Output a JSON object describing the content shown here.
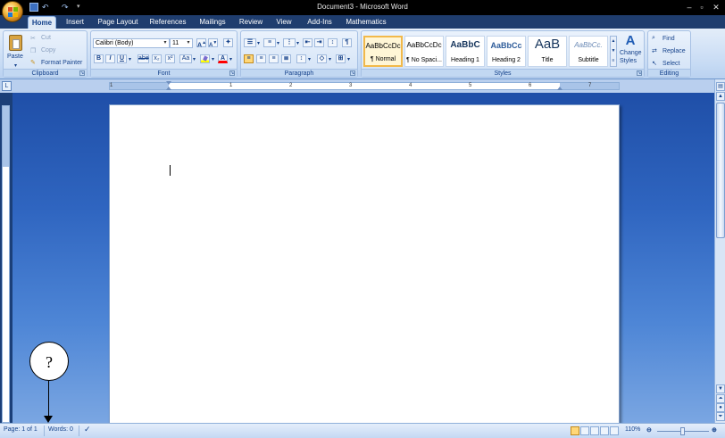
{
  "window": {
    "title": "Document3 - Microsoft Word"
  },
  "tabs": [
    {
      "label": "Home",
      "active": true
    },
    {
      "label": "Insert"
    },
    {
      "label": "Page Layout"
    },
    {
      "label": "References"
    },
    {
      "label": "Mailings"
    },
    {
      "label": "Review"
    },
    {
      "label": "View"
    },
    {
      "label": "Add-Ins"
    },
    {
      "label": "Mathematics"
    }
  ],
  "clipboard": {
    "paste": "Paste",
    "cut": "Cut",
    "copy": "Copy",
    "format_painter": "Format Painter",
    "group_label": "Clipboard"
  },
  "font": {
    "name": "Calibri (Body)",
    "size": "11",
    "group_label": "Font",
    "bold": "B",
    "italic": "I",
    "underline": "U",
    "strike": "abe",
    "subscript": "x₂",
    "superscript": "x²",
    "change_case": "Aa",
    "color_letter": "A"
  },
  "paragraph": {
    "group_label": "Paragraph"
  },
  "styles": {
    "group_label": "Styles",
    "items": [
      {
        "preview": "AaBbCcDc",
        "name": "¶ Normal",
        "selected": true
      },
      {
        "preview": "AaBbCcDc",
        "name": "¶ No Spaci..."
      },
      {
        "preview": "AaBbC",
        "name": "Heading 1"
      },
      {
        "preview": "AaBbCc",
        "name": "Heading 2"
      },
      {
        "preview": "AaB",
        "name": "Title"
      },
      {
        "preview": "AaBbCc.",
        "name": "Subtitle"
      }
    ],
    "change_styles_line1": "Change",
    "change_styles_line2": "Styles"
  },
  "editing": {
    "group_label": "Editing",
    "find": "Find",
    "replace": "Replace",
    "select": "Select"
  },
  "ruler": {
    "numbers": [
      "1",
      "1",
      "2",
      "3",
      "4",
      "5",
      "6",
      "7"
    ]
  },
  "statusbar": {
    "page": "Page: 1 of 1",
    "words": "Words: 0",
    "zoom": "110%"
  },
  "annotation": {
    "label": "?"
  },
  "colors": {
    "accent": "#15428b",
    "highlight": "#ffff00",
    "font_color": "#ff0000"
  }
}
